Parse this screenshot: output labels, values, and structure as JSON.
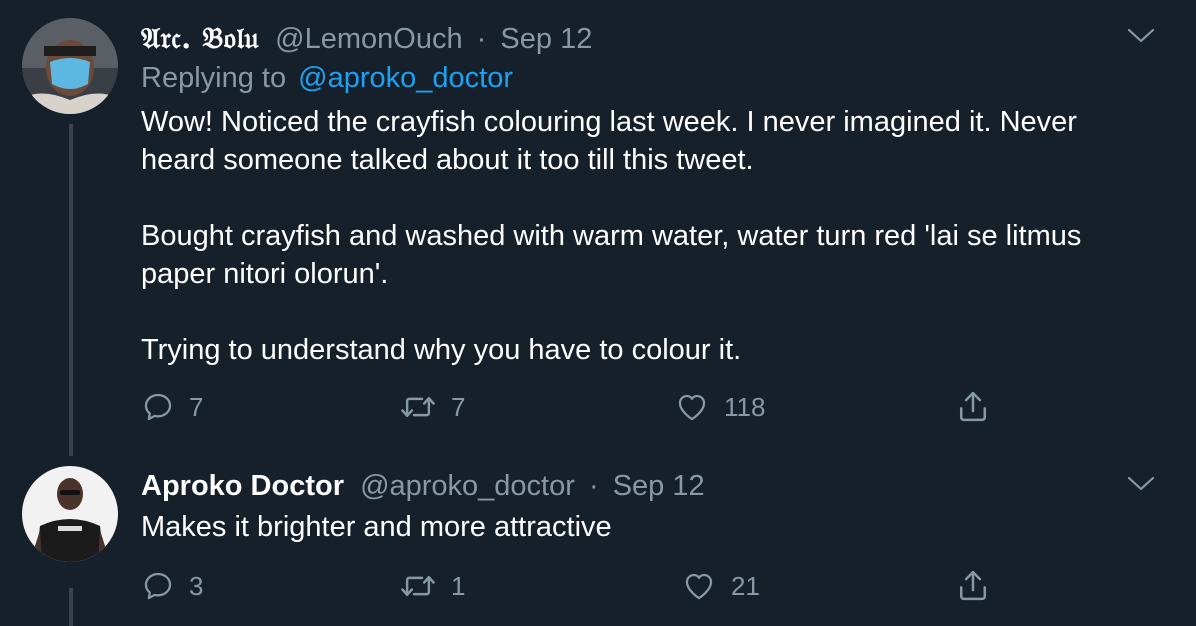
{
  "tweets": [
    {
      "display_name": "𝔄𝔯𝔠. 𝔅𝔬𝔩𝔲",
      "handle": "@LemonOuch",
      "separator": "·",
      "date": "Sep 12",
      "replying_prefix": "Replying to",
      "replying_to": "@aproko_doctor",
      "lines": [
        "Wow! Noticed the crayfish colouring last week. I never imagined it. Never",
        "heard someone talked about it too till this tweet.",
        "",
        "Bought crayfish and washed with warm water, water turn red 'lai se litmus",
        "paper nitori olorun'.",
        "",
        "Trying to understand why you have to colour it."
      ],
      "reply_count": "7",
      "retweet_count": "7",
      "like_count": "118"
    },
    {
      "display_name": "Aproko Doctor",
      "handle": "@aproko_doctor",
      "separator": "·",
      "date": "Sep 12",
      "lines": [
        "Makes it brighter and more attractive"
      ],
      "reply_count": "3",
      "retweet_count": "1",
      "like_count": "21"
    }
  ],
  "icons": {
    "reply": "reply-icon",
    "retweet": "retweet-icon",
    "like": "heart-icon",
    "share": "share-icon",
    "more": "chevron-down-icon"
  },
  "colors": {
    "background": "#15202b",
    "secondary_text": "#8899a6",
    "link": "#1da1f2",
    "thread_line": "#38444d"
  }
}
